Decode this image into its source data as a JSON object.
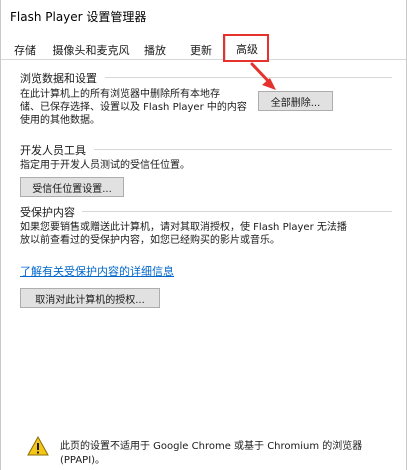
{
  "window": {
    "title": "Flash Player 设置管理器"
  },
  "tabs": [
    {
      "label": "存储"
    },
    {
      "label": "摄像头和麦克风"
    },
    {
      "label": "播放"
    },
    {
      "label": "更新"
    },
    {
      "label": "高级",
      "active": true
    }
  ],
  "browsing": {
    "title": "浏览数据和设置",
    "lines": [
      "在此计算机上的所有浏览器中删除所有本地存",
      "储、已保存选择、设置以及 Flash Player 中的内容",
      "使用的其他数据。"
    ],
    "button_label": "全部删除..."
  },
  "developer": {
    "title": "开发人员工具",
    "description": "指定用于开发人员测试的受信任位置。",
    "button_label": "受信任位置设置..."
  },
  "protected": {
    "title": "受保护内容",
    "lines": [
      "如果您要销售或赠送此计算机，请对其取消授权，使 Flash Player 无法播",
      "放以前查看过的受保护内容，如您已经购买的影片或音乐。"
    ],
    "link_text": "了解有关受保护内容的详细信息",
    "button_label": "取消对此计算机的授权..."
  },
  "notice": {
    "icon": "warning-icon",
    "lines": [
      "此页的设置不适用于 Google Chrome 或基于 Chromium 的浏览器",
      "(PPAPI)。"
    ]
  },
  "colors": {
    "annotation": "#e5322d",
    "link": "#0066cc",
    "warning_fill": "#f5c518"
  }
}
